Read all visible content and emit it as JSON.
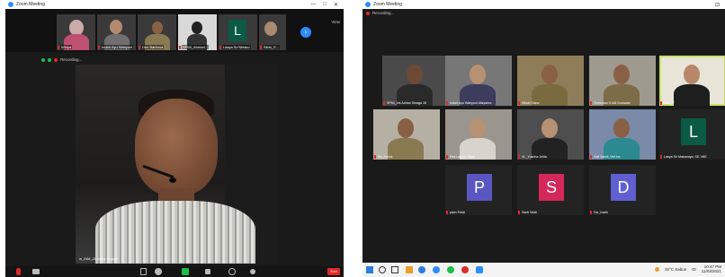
{
  "windows": [
    {
      "title": "Zoom Meeting",
      "controls": [
        "—",
        "□",
        "✕"
      ],
      "view_button": "View",
      "recording_label": "Recording...",
      "strip": [
        {
          "name": "Winya"
        },
        {
          "name": "Indah Ayu Wahyuni"
        },
        {
          "name": "Deo Barbosa"
        },
        {
          "name": "SPMI_Ahmad..."
        },
        {
          "name": "Lasya Sri Mesko"
        },
        {
          "name": "Sibin_E..."
        }
      ],
      "speaker_name": "w_INM_Z6 Arliia Sinaga",
      "end_label": "End"
    },
    {
      "title": "Zoom Meeting",
      "controls": [
        "⊡"
      ],
      "recording_label": "Recording...",
      "tiles": [
        {
          "name": "SPMI_Iris Adrian Sinaga 16",
          "kind": "video"
        },
        {
          "name": "Indah Ayu Wahyuni Alisyahra",
          "kind": "video"
        },
        {
          "name": "Wiwin Tiana",
          "kind": "video"
        },
        {
          "name": "Tomorrow S Adi Gunawat",
          "kind": "video"
        },
        {
          "name": "SMK_T",
          "kind": "video",
          "active": true
        },
        {
          "name": "Elu Zuhria",
          "kind": "video"
        },
        {
          "name": "Rini Lagoni Hardi",
          "kind": "video"
        },
        {
          "name": "VL_Yusrina Jelita",
          "kind": "video"
        },
        {
          "name": "Kafi Sandi_Vet Inc",
          "kind": "video"
        },
        {
          "name": "Lasya Sri Makanaya, SE, MIE",
          "kind": "letter",
          "letter": "L",
          "color": "#0b5a45"
        },
        {
          "name": "pipin Pardi",
          "kind": "letter",
          "letter": "P",
          "color": "#5b57c2"
        },
        {
          "name": "Santi Wulli",
          "kind": "letter",
          "letter": "S",
          "color": "#d4285b"
        },
        {
          "name": "Dw_Inarik",
          "kind": "letter",
          "letter": "D",
          "color": "#5f5fd1"
        }
      ],
      "taskbar": {
        "weather": "32°C Sabun",
        "lang": "ID",
        "time": "10:47 PM",
        "date": "11/03/2021"
      }
    }
  ],
  "colors": {
    "zoom_blue": "#2d8cff",
    "mute_red": "#e02828",
    "active_outline": "#c8e06a",
    "share_green": "#1bbf4b"
  }
}
